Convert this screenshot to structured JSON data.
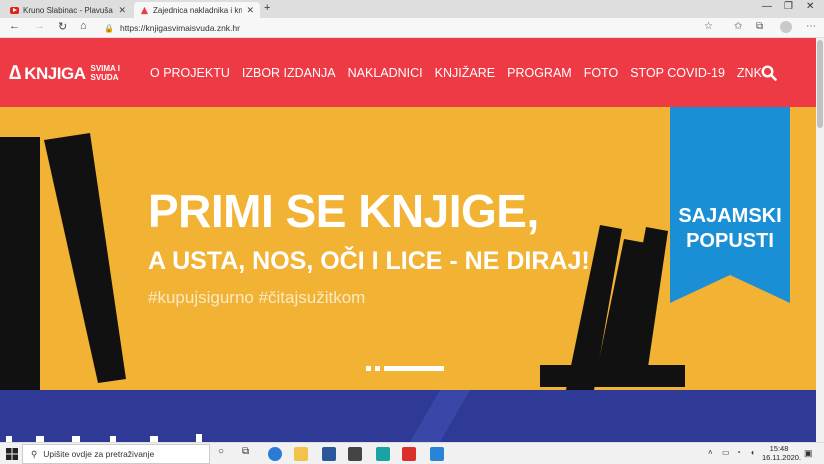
{
  "browser": {
    "tabs": [
      {
        "title": "Kruno Slabinac - Plavuša - YouTu",
        "icon": "youtube-icon"
      },
      {
        "title": "Zajednica nakladnika i knjižara |",
        "icon": "knjiga-favicon-icon"
      }
    ],
    "url": "https://knjigasvimaisvuda.znk.hr"
  },
  "site": {
    "logo": {
      "mark": "∆",
      "name": "KNJIGA",
      "sub1": "SVIMA I",
      "sub2": "SVUDA"
    },
    "menu": [
      "O PROJEKTU",
      "IZBOR IZDANJA",
      "NAKLADNICI",
      "KNJIŽARE",
      "PROGRAM",
      "FOTO",
      "STOP COVID-19",
      "ZNK"
    ],
    "colors": {
      "header": "#ed3a45",
      "hero": "#f2b233",
      "ribbon": "#1b8fd6",
      "lower": "#2e3a96"
    }
  },
  "hero": {
    "headline": "PRIMI SE KNJIGE,",
    "subline": "A USTA, NOS, OČI I LICE - NE DIRAJ!",
    "hashtags": "#kupujsigurno #čitajsužitkom",
    "ribbon_line1": "SAJAMSKI",
    "ribbon_line2": "POPUSTI"
  },
  "taskbar": {
    "search_placeholder": "Upišite ovdje za pretraživanje",
    "time": "15:48",
    "date": "16.11.2020."
  }
}
